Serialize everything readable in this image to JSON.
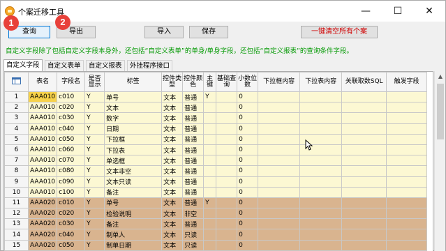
{
  "window": {
    "title": "个案迁移工具",
    "minimize": "—",
    "maximize": "☐",
    "close": "✕"
  },
  "toolbar": {
    "query_label": "查询",
    "export_label": "导出",
    "import_label": "导入",
    "save_label": "保存",
    "clear_label": "一键清空所有个案",
    "badge1": "1",
    "badge2": "2"
  },
  "hint_text": "自定义字段除了包括自定义字段本身外，还包括“自定义表单”的单身/单身字段，还包括“自定义报表”的查询条件字段。",
  "tabs": [
    "自定义字段",
    "自定义表单",
    "自定义报表",
    "外挂程序接口"
  ],
  "grid": {
    "headers": [
      "表名",
      "字段名",
      "是否显示",
      "标签",
      "控件类型",
      "控件颜色",
      "主键",
      "基础查询",
      "小数位数",
      "下拉框内容",
      "下拉表内容",
      "关联取数SQL",
      "触发字段"
    ],
    "rows": [
      {
        "n": "1",
        "table": "AAA010",
        "field": "c010",
        "show": "Y",
        "label": "单号",
        "ctype": "文本",
        "color": "普通",
        "pk": "Y",
        "base": "",
        "dec": "0",
        "group": 1
      },
      {
        "n": "2",
        "table": "AAA010",
        "field": "c020",
        "show": "Y",
        "label": "文本",
        "ctype": "文本",
        "color": "普通",
        "pk": "",
        "base": "",
        "dec": "0",
        "group": 1
      },
      {
        "n": "3",
        "table": "AAA010",
        "field": "c030",
        "show": "Y",
        "label": "数字",
        "ctype": "文本",
        "color": "普通",
        "pk": "",
        "base": "",
        "dec": "0",
        "group": 1
      },
      {
        "n": "4",
        "table": "AAA010",
        "field": "c040",
        "show": "Y",
        "label": "日期",
        "ctype": "文本",
        "color": "普通",
        "pk": "",
        "base": "",
        "dec": "0",
        "group": 1
      },
      {
        "n": "5",
        "table": "AAA010",
        "field": "c050",
        "show": "Y",
        "label": "下拉框",
        "ctype": "文本",
        "color": "普通",
        "pk": "",
        "base": "",
        "dec": "0",
        "group": 1
      },
      {
        "n": "6",
        "table": "AAA010",
        "field": "c060",
        "show": "Y",
        "label": "下拉表",
        "ctype": "文本",
        "color": "普通",
        "pk": "",
        "base": "",
        "dec": "0",
        "group": 1
      },
      {
        "n": "7",
        "table": "AAA010",
        "field": "c070",
        "show": "Y",
        "label": "单选框",
        "ctype": "文本",
        "color": "普通",
        "pk": "",
        "base": "",
        "dec": "0",
        "group": 1
      },
      {
        "n": "8",
        "table": "AAA010",
        "field": "c080",
        "show": "Y",
        "label": "文本非空",
        "ctype": "文本",
        "color": "普通",
        "pk": "",
        "base": "",
        "dec": "0",
        "group": 1
      },
      {
        "n": "9",
        "table": "AAA010",
        "field": "c090",
        "show": "Y",
        "label": "文本只读",
        "ctype": "文本",
        "color": "普通",
        "pk": "",
        "base": "",
        "dec": "0",
        "group": 1
      },
      {
        "n": "10",
        "table": "AAA010",
        "field": "c100",
        "show": "Y",
        "label": "备注",
        "ctype": "文本",
        "color": "普通",
        "pk": "",
        "base": "",
        "dec": "0",
        "group": 1
      },
      {
        "n": "11",
        "table": "AAA020",
        "field": "c010",
        "show": "Y",
        "label": "单号",
        "ctype": "文本",
        "color": "普通",
        "pk": "Y",
        "base": "",
        "dec": "0",
        "group": 2
      },
      {
        "n": "12",
        "table": "AAA020",
        "field": "c020",
        "show": "Y",
        "label": "检验说明",
        "ctype": "文本",
        "color": "非空",
        "pk": "",
        "base": "",
        "dec": "0",
        "group": 2
      },
      {
        "n": "13",
        "table": "AAA020",
        "field": "c030",
        "show": "Y",
        "label": "备注",
        "ctype": "文本",
        "color": "普通",
        "pk": "",
        "base": "",
        "dec": "0",
        "group": 2
      },
      {
        "n": "14",
        "table": "AAA020",
        "field": "c040",
        "show": "Y",
        "label": "制单人",
        "ctype": "文本",
        "color": "只读",
        "pk": "",
        "base": "",
        "dec": "0",
        "group": 2
      },
      {
        "n": "15",
        "table": "AAA020",
        "field": "c050",
        "show": "Y",
        "label": "制单日期",
        "ctype": "文本",
        "color": "只读",
        "pk": "",
        "base": "",
        "dec": "0",
        "group": 2
      }
    ]
  }
}
